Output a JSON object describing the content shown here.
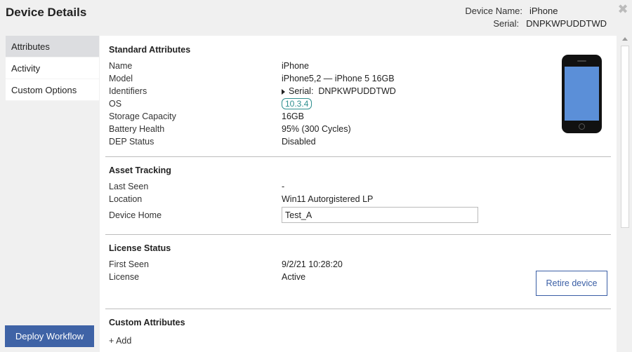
{
  "header": {
    "title": "Device Details",
    "device_name_label": "Device Name:",
    "device_name": "iPhone",
    "serial_label": "Serial:",
    "serial": "DNPKWPUDDTWD",
    "close_icon": "✖"
  },
  "sidebar": {
    "items": [
      {
        "label": "Attributes",
        "active": true
      },
      {
        "label": "Activity"
      },
      {
        "label": "Custom Options"
      }
    ],
    "deploy_label": "Deploy Workflow"
  },
  "standard": {
    "heading": "Standard Attributes",
    "name_label": "Name",
    "name": "iPhone",
    "model_label": "Model",
    "model": "iPhone5,2 — iPhone 5 16GB",
    "identifiers_label": "Identifiers",
    "identifiers": "Serial:  DNPKWPUDDTWD",
    "os_label": "OS",
    "os": "10.3.4",
    "storage_label": "Storage Capacity",
    "storage": "16GB",
    "battery_label": "Battery Health",
    "battery": "95% (300 Cycles)",
    "dep_label": "DEP Status",
    "dep": "Disabled"
  },
  "asset": {
    "heading": "Asset Tracking",
    "last_seen_label": "Last Seen",
    "last_seen": "-",
    "location_label": "Location",
    "location": "Win11 Autorgistered LP",
    "home_label": "Device Home",
    "home_value": "Test_A"
  },
  "license": {
    "heading": "License Status",
    "first_seen_label": "First Seen",
    "first_seen": "9/2/21 10:28:20",
    "license_label": "License",
    "license": "Active",
    "retire_label": "Retire device"
  },
  "custom": {
    "heading": "Custom Attributes",
    "add_label": "+ Add"
  }
}
